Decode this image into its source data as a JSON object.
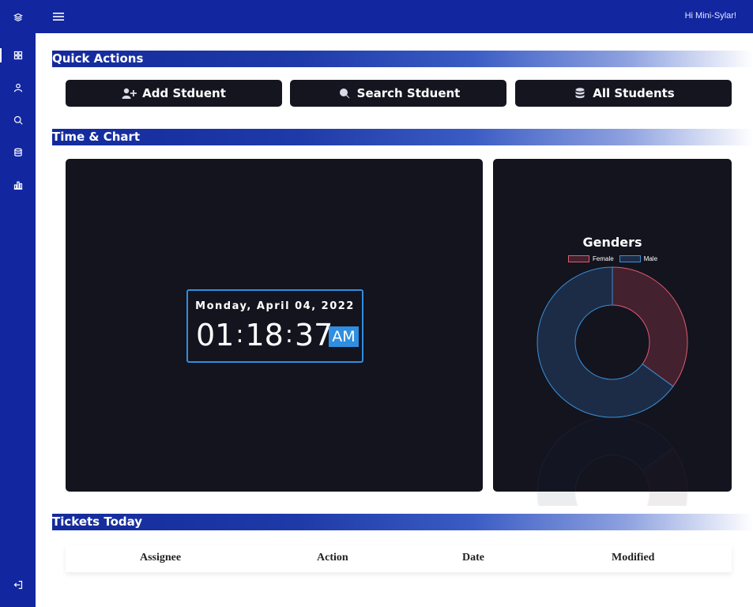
{
  "header": {
    "greeting": "Hi Mini-Sylar!"
  },
  "sidebar": {
    "items": [
      {
        "icon": "layers-icon"
      },
      {
        "icon": "dashboard-grid-icon",
        "active": true
      },
      {
        "icon": "user-icon"
      },
      {
        "icon": "search-icon"
      },
      {
        "icon": "database-icon"
      },
      {
        "icon": "bar-chart-icon"
      }
    ],
    "logout_icon": "logout-icon"
  },
  "sections": {
    "quick_actions": "Quick Actions",
    "time_chart": "Time & Chart",
    "tickets_today": "Tickets Today"
  },
  "quick_actions": {
    "add_student": "Add Stduent",
    "search_student": "Search Stduent",
    "all_students": "All Students"
  },
  "clock": {
    "date": "Monday, April 04, 2022",
    "hours": "01",
    "minutes": "18",
    "seconds": "37",
    "ampm": "AM"
  },
  "chart_data": {
    "type": "pie",
    "subtype": "doughnut",
    "title": "Genders",
    "legend_position": "top",
    "series": [
      {
        "name": "Female",
        "value": 35,
        "color": "#e05a6e",
        "fill": "#43212f"
      },
      {
        "name": "Male",
        "value": 65,
        "color": "#3a8fd6",
        "fill": "#1c2c47"
      }
    ]
  },
  "tickets": {
    "columns": [
      "Assignee",
      "Action",
      "Date",
      "Modified"
    ]
  },
  "colors": {
    "brand": "#1226a0",
    "panel": "#14141f",
    "accent": "#2f8ee0"
  }
}
